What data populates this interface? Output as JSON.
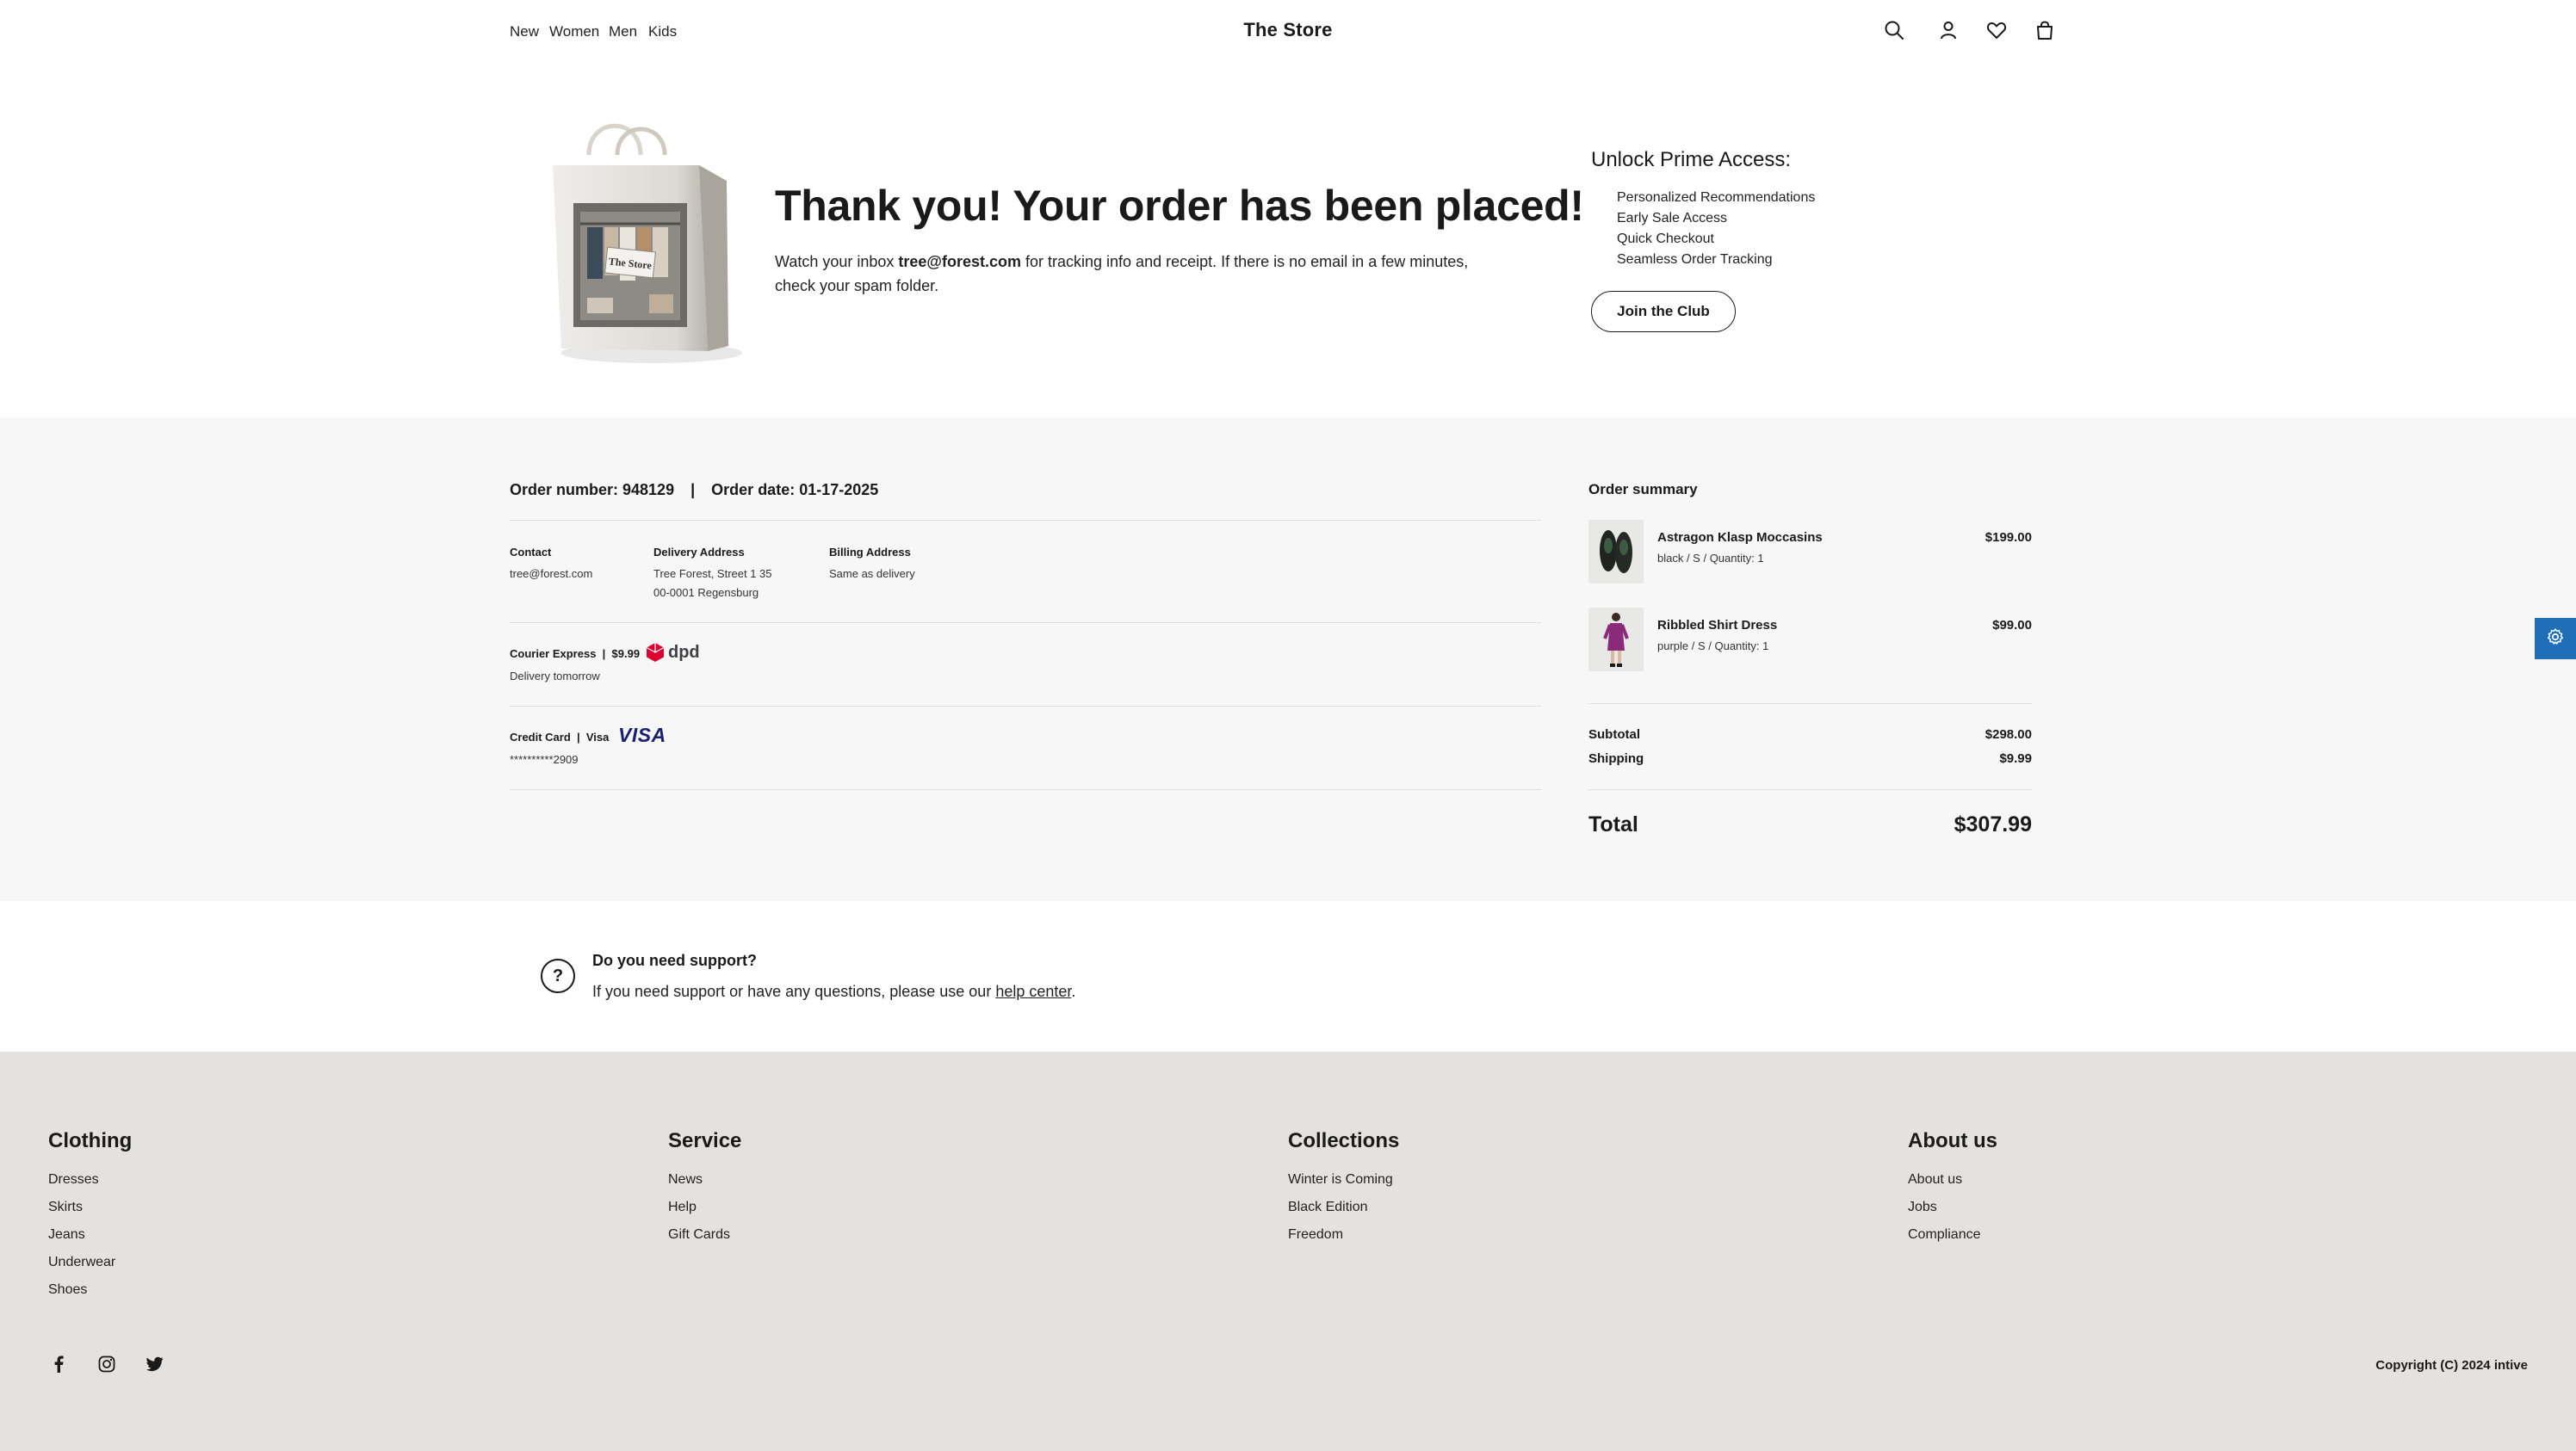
{
  "header": {
    "nav": [
      "New",
      "Women",
      "Men",
      "Kids"
    ],
    "brand": "The Store",
    "icons": [
      "search-icon",
      "account-icon",
      "wishlist-icon",
      "cart-icon"
    ]
  },
  "hero": {
    "bag_label": "The Store",
    "title": "Thank you! Your order has been placed!",
    "text_before": "Watch your inbox ",
    "email": "tree@forest.com",
    "text_after": " for tracking info and receipt. If there is no email in a few minutes, check your spam folder."
  },
  "prime": {
    "title": "Unlock Prime Access:",
    "benefits": [
      "Personalized Recommendations",
      "Early Sale Access",
      "Quick Checkout",
      "Seamless Order Tracking"
    ],
    "button": "Join the Club"
  },
  "order": {
    "number_label": "Order number: 948129",
    "separator": "|",
    "date_label": "Order date: 01-17-2025",
    "contact_label": "Contact",
    "contact_value": "tree@forest.com",
    "delivery_label": "Delivery Address",
    "delivery_line1": "Tree Forest, Street 1 35",
    "delivery_line2": "00-0001 Regensburg",
    "billing_label": "Billing Address",
    "billing_value": "Same as delivery",
    "shipping_method": "Courier Express  |  $9.99",
    "carrier_logo": "dpd",
    "shipping_eta": "Delivery tomorrow",
    "payment_method": "Credit Card  |  Visa",
    "payment_logo": "VISA",
    "card_number": "**********2909"
  },
  "summary": {
    "title": "Order summary",
    "items": [
      {
        "name": "Astragon Klasp Moccasins",
        "meta": "black / S / Quantity: 1",
        "price": "$199.00"
      },
      {
        "name": "Ribbled Shirt Dress",
        "meta": "purple / S / Quantity: 1",
        "price": "$99.00"
      }
    ],
    "subtotal_label": "Subtotal",
    "subtotal": "$298.00",
    "shipping_label": "Shipping",
    "shipping": "$9.99",
    "total_label": "Total",
    "total": "$307.99"
  },
  "support": {
    "icon": "?",
    "title": "Do you need support?",
    "text": "If you need support or have any questions, please use our ",
    "link": "help center",
    "end": "."
  },
  "footer": {
    "columns": [
      {
        "title": "Clothing",
        "links": [
          "Dresses",
          "Skirts",
          "Jeans",
          "Underwear",
          "Shoes"
        ]
      },
      {
        "title": "Service",
        "links": [
          "News",
          "Help",
          "Gift Cards"
        ]
      },
      {
        "title": "Collections",
        "links": [
          "Winter is Coming",
          "Black Edition",
          "Freedom"
        ]
      },
      {
        "title": "About us",
        "links": [
          "About us",
          "Jobs",
          "Compliance"
        ]
      }
    ],
    "social": [
      "facebook-icon",
      "instagram-icon",
      "twitter-icon"
    ],
    "copyright": "Copyright (C) 2024 intive"
  },
  "colors": {
    "accent": "#1e6fb8",
    "order_band": "#f7f7f7",
    "footer_bg": "#e3e2e0",
    "dpd_red": "#dc0032",
    "visa_blue": "#1a1f71"
  }
}
